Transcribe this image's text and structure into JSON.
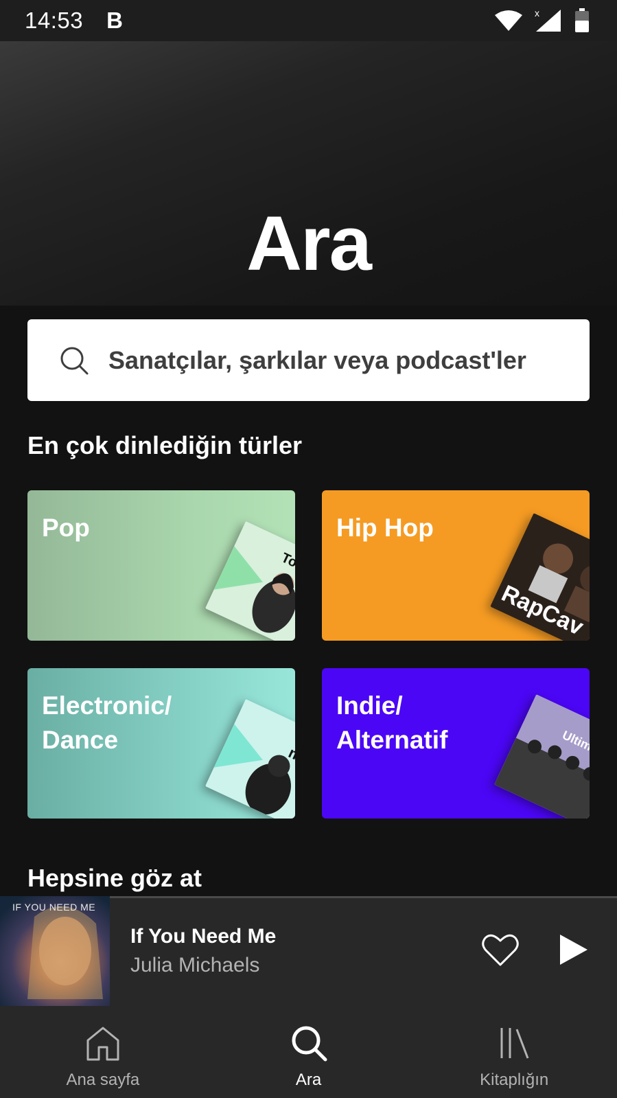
{
  "status_bar": {
    "time": "14:53",
    "notification_letter": "B",
    "icons": [
      "wifi-icon",
      "signal-icon",
      "battery-icon"
    ]
  },
  "hero": {
    "title": "Ara"
  },
  "search": {
    "placeholder": "Sanatçılar, şarkılar veya podcast'ler",
    "icon": "search-icon"
  },
  "top_genres": {
    "title": "En çok dinlediğin türler",
    "items": [
      {
        "label": "Pop",
        "color": "#9cc8a0",
        "cover_text": "Today's Top H"
      },
      {
        "label": "Hip Hop",
        "color": "#f59b23",
        "cover_text": "RapCav"
      },
      {
        "label": "Electronic/\nDance",
        "color": "#86d1c6",
        "cover_text": "mim"
      },
      {
        "label": "Indie/\nAlternatif",
        "color": "#4b06f5",
        "cover_text": "Ultimate I"
      }
    ]
  },
  "browse_all": {
    "title": "Hepsine göz at"
  },
  "now_playing": {
    "title": "If You Need Me",
    "artist": "Julia Michaels",
    "album_art_text": "IF YOU NEED ME",
    "progress": 0.04
  },
  "bottom_nav": {
    "items": [
      {
        "label": "Ana sayfa",
        "icon": "home-icon",
        "active": false
      },
      {
        "label": "Ara",
        "icon": "search-icon",
        "active": true
      },
      {
        "label": "Kitaplığın",
        "icon": "library-icon",
        "active": false
      }
    ]
  }
}
